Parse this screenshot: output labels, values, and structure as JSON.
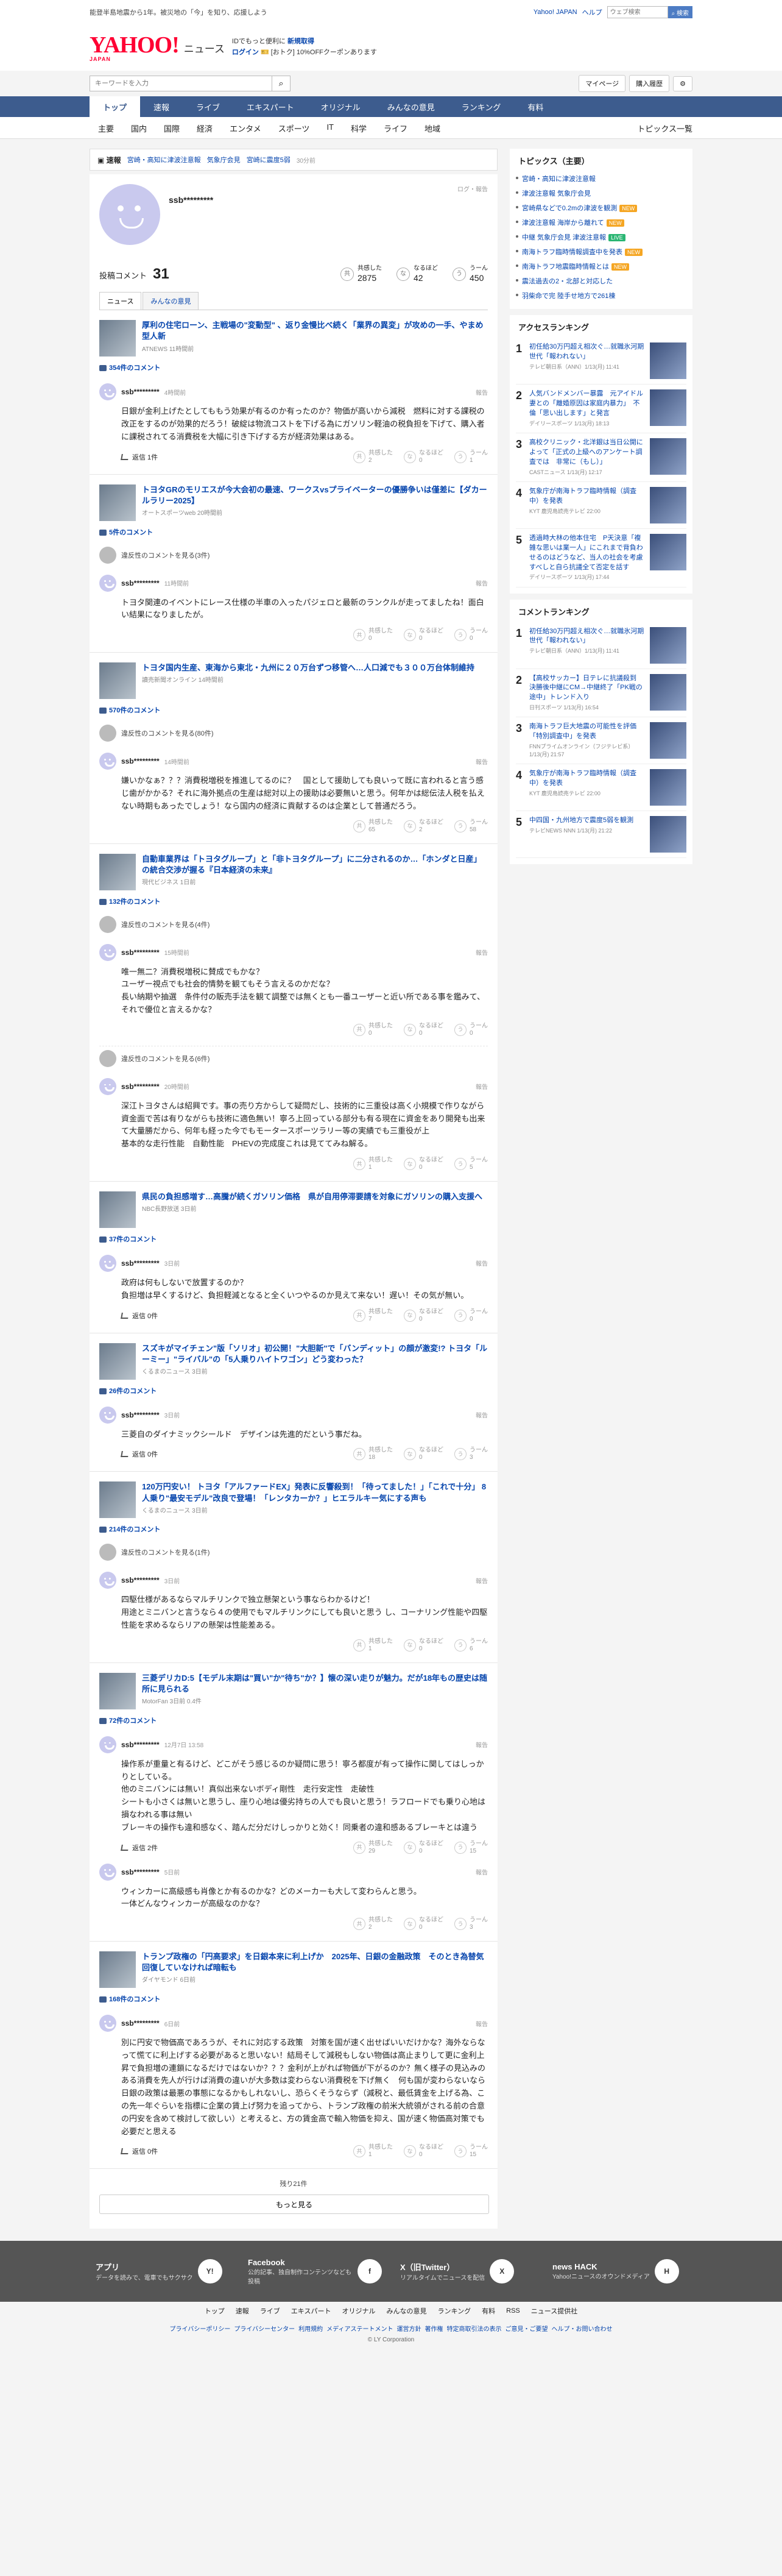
{
  "topbar": {
    "promo": "能登半島地震から1年。被災地の「今」を知り、応援しよう",
    "links": [
      "Yahoo! JAPAN",
      "ヘルプ"
    ],
    "search_placeholder": "ウェブ検索",
    "search_button": "⌕ 検索"
  },
  "mast": {
    "logo": "YAHOO!",
    "logo_sub": "JAPAN",
    "brand": "ニュース",
    "line1": "IDでもっと便利に",
    "line1_link": "新規取得",
    "login": "ログイン",
    "login_note": "[おトク] 10%OFFクーポンあります"
  },
  "search": {
    "placeholder": "キーワードを入力",
    "mypage": "マイページ",
    "purchase": "購入履歴"
  },
  "gnav": [
    "トップ",
    "速報",
    "ライブ",
    "エキスパート",
    "オリジナル",
    "みんなの意見",
    "ランキング",
    "有料"
  ],
  "subnav": {
    "cats": [
      "主要",
      "国内",
      "国際",
      "経済",
      "エンタメ",
      "スポーツ",
      "IT",
      "科学",
      "ライフ",
      "地域"
    ],
    "list": "トピックス一覧"
  },
  "breaking": {
    "tag": "速報",
    "items": [
      "宮崎・高知に津波注意報",
      "気象庁会見",
      "宮崎に震度5弱"
    ],
    "time": "30分前"
  },
  "profile": {
    "name": "ssb*********",
    "report": "ログ・報告",
    "comments_label": "投稿コメント",
    "comments": "31",
    "reactions": [
      {
        "icon": "共",
        "label": "共感した",
        "value": "2875"
      },
      {
        "icon": "な",
        "label": "なるほど",
        "value": "42"
      },
      {
        "icon": "う",
        "label": "うーん",
        "value": "450"
      }
    ]
  },
  "tabs": [
    "ニュース",
    "みんなの意見"
  ],
  "items": [
    {
      "title": "厚利の住宅ローン、主戦場の\"変動型\" 、返り金慢比べ続く「業界の異変」が攻めの一手、やまめ型人新",
      "source": "ATNEWS 11時間前",
      "count": "354件のコメント",
      "comments": [
        {
          "user": "ssb*********",
          "date": "4時間前",
          "text": "日銀が金利上げたとしてももう効果が有るのか有ったのか？物価が高いから減税　燃料に対する課税の改正をするのが効果的だろう！破綻は物流コストを下げる為にガソリン軽油の税負担を下げて、購入者に課税されてる消費税を大幅に引き下げする方が経済効果はある。",
          "reply": "返信 1件",
          "r": [
            "2",
            "0",
            "1"
          ]
        }
      ]
    },
    {
      "title": "トヨタGRのモリエスが今大会初の最速、ワークスvsプライベーターの優勝争いは僅差に【ダカールラリー2025】",
      "source": "オートスポーツweb 20時間前",
      "count": "5件のコメント",
      "deleted": "違反性のコメントを見る(3件)",
      "comments": [
        {
          "user": "ssb*********",
          "date": "11時間前",
          "text": "トヨタ関連のイベントにレース仕様の半車の入ったパジェロと最新のランクルが走ってましたね！面白い結果になりましたが。",
          "r": [
            "0",
            "0",
            "0"
          ]
        }
      ]
    },
    {
      "title": "トヨタ国内生産、東海から東北・九州に２０万台ずつ移管へ…人口減でも３００万台体制維持",
      "source": "讀売新聞オンライン 14時間前",
      "count": "570件のコメント",
      "deleted": "違反性のコメントを見る(80件)",
      "comments": [
        {
          "user": "ssb*********",
          "date": "14時間前",
          "text": "嫌いかなぁ？？？消費税増税を推進してるのに？　国として援助しても良いって既に言われると言う感じ歯がかかる？それに海外拠点の生産は総対以上の援助は必要無いと思う。何年かは総伝法人税を払えない時期もあったでしょう！なら国内の経済に貢献するのは企業として普通だろう。",
          "r": [
            "65",
            "2",
            "58"
          ]
        }
      ]
    },
    {
      "title": "自動車業界は「トヨタグループ」と「非トヨタグループ」に二分されるのか…「ホンダと日産」の統合交渉が握る『日本経済の未来』",
      "source": "現代ビジネス 1日前",
      "count": "132件のコメント",
      "deleted": "違反性のコメントを見る(4件)",
      "comments": [
        {
          "user": "ssb*********",
          "date": "15時間前",
          "text": "唯一無二？消費税増税に賛成でもかな？\nユーザー視点でも社会的情勢を観てもそう言えるのかだな？\n長い納期や抽選　条件付の販売手法を観て調整では無くとも一番ユーザーと近い所である事を鑑みて、それで優位と言えるかな？",
          "r": [
            "0",
            "0",
            "0"
          ]
        }
      ],
      "deleted2": "違反性のコメントを見る(6件)",
      "comments2": [
        {
          "user": "ssb*********",
          "date": "20時間前",
          "text": "深江トヨタさんは紹興です。事の売り方からして疑問だし、技術的に三重役は高く小規模で作りながら資金面で苦は有りながらも技術に適色無い！寧ろ上回っている部分も有る現在に資金をあり開発も出来て大量勝だから、何年も経った今でもモータースポーツラリー等の実績でも三重役が上\n基本的な走行性能　自動性能　PHEVの完成度これは見ててみね解る。",
          "r": [
            "1",
            "0",
            "5"
          ]
        }
      ]
    },
    {
      "title": "県民の負担感増す…高騰が続くガソリン価格　県が自用停滞要請を対象にガソリンの購入支援へ",
      "source": "NBC長野放送 3日前",
      "count": "37件のコメント",
      "comments": [
        {
          "user": "ssb*********",
          "date": "3日前",
          "text": "政府は何もしないで放置するのか？\n負担増は早くするけど、負担軽減となると全くいつやるのか見えて来ない！遅い！その気が無い。",
          "reply": "返信 0件",
          "r": [
            "7",
            "0",
            "0"
          ]
        }
      ]
    },
    {
      "title": "スズキがマイチェン\"版「ソリオ」初公開！\"大胆新\"で「バンディット」の顔が激変!? トヨタ「ルーミー」\"ライバル\"の「5人乗りハイトワゴン」どう変わった？",
      "source": "くるまのニュース 3日前",
      "count": "26件のコメント",
      "comments": [
        {
          "user": "ssb*********",
          "date": "3日前",
          "text": "三菱自のダイナミックシールド　デザインは先進的だという事だね。",
          "reply": "返信 0件",
          "r": [
            "18",
            "0",
            "3"
          ]
        }
      ]
    },
    {
      "title": "120万円安い！ トヨタ「アルファードEX」発表に反響殺到！「待ってました！」「これで十分」 8人乗り\"最安モデル\"改良で登場！「レンタカーか？」ヒエラルキー気にする声も",
      "source": "くるまのニュース 3日前",
      "count": "214件のコメント",
      "deleted": "違反性のコメントを見る(1件)",
      "comments": [
        {
          "user": "ssb*********",
          "date": "3日前",
          "text": "四駆仕様があるならマルチリンクで独立懸架という事ならわかるけど！\n用途とミニバンと言うなら４の使用でもマルチリンクにしても良いと思う し、コーナリング性能や四駆性能を求めるならリアの懸架は性能差ある。",
          "r": [
            "1",
            "0",
            "6"
          ]
        }
      ]
    },
    {
      "title": "三菱デリカD:5【モデル末期は\"買い\"か\"待ち\"か？】懐の深い走りが魅力。だが18年もの歴史は随所に見られる",
      "source": "MotorFan 3日前 0.4件",
      "count": "72件のコメント",
      "comments": [
        {
          "user": "ssb*********",
          "date": "12月7日 13:58",
          "text": "操作系が重量と有るけど、どこがそう感じるのか疑問に思う！寧ろ都度が有って操作に関してはしっかりとしている。\n他のミニバンには無い！真似出来ないボディ剛性　走行安定性　走破性\nシートも小さくは無いと思うし、座り心地は優劣持ちの人でも良いと思う！ラフロードでも乗り心地は損なわれる事は無い\nブレーキの操作も違和感なく、踏んだ分だけしっかりと効く！同乗者の違和感あるブレーキとは違う",
          "reply": "返信 2件",
          "r": [
            "29",
            "0",
            "15"
          ]
        },
        {
          "user": "ssb*********",
          "date": "5日前",
          "text": "ウィンカーに高級感も肖像とか有るのかな？どのメーカーも大して変わらんと思う。\n一体どんなウィンカーが高級なのかな？",
          "r": [
            "2",
            "0",
            "3"
          ]
        }
      ]
    },
    {
      "title": "トランプ政権の「円高要求」を日銀本来に利上げか　2025年、日銀の金融政策　そのとき為替気回復していなければ暗転も",
      "source": "ダイヤモンド 6日前",
      "count": "168件のコメント",
      "comments": [
        {
          "user": "ssb*********",
          "date": "6日前",
          "text": "別に円安で物価高であろうが、それに対応する政策　対策を国が速く出せばいいだけかな？海外ならなって慌てに利上げする必要があると思いない！結局そして減税もしない物価は高止まりして更に金利上昇で負担増の連鎖になるだけではないか？？？金利が上がれば物価が下がるのか？無く様子の見込みのある消費を先人が行けば消費の違いが大多数は変わらない消費税を下げ無く　何も国が変わらないなら日銀の政策は最悪の事態になるかもしれないし、恐らくそうならず（減税と、最低賃金を上げる為、この先一年ぐらいを指標に企業の賃上げ努力を追ってから、トランプ政権の前米大統領がされる前の合意の円安を含めて検討して欲しい）と考えると、方の賃金高で輸入物価を抑え、国が速く物価高対策でも必要だと思える",
          "reply": "返信 0件",
          "r": [
            "1",
            "0",
            "15"
          ]
        }
      ]
    }
  ],
  "more": {
    "remaining": "残り21件",
    "button": "もっと見る"
  },
  "side": {
    "topics_title": "トピックス（主要）",
    "topics": [
      {
        "t": "宮崎・高知に津波注意報",
        "b": ""
      },
      {
        "t": "津波注意報 気象庁会見",
        "b": ""
      },
      {
        "t": "宮崎県などで0.2mの津波を観測",
        "b": "NEW"
      },
      {
        "t": "津波注意報 海岸から離れて",
        "b": "NEW"
      },
      {
        "t": "中継 気象庁会見 津波注意報",
        "b": "LIVE"
      },
      {
        "t": "南海トラフ臨時情報調査中を発表",
        "b": "NEW"
      },
      {
        "t": "南海トラフ地震臨時情報とは",
        "b": "NEW"
      },
      {
        "t": "震法過去の2・北部と対応した",
        "b": ""
      },
      {
        "t": "羽柴命で完 陸手せ地方で261棟",
        "b": ""
      }
    ],
    "access_title": "アクセスランキング",
    "access": [
      {
        "n": "1",
        "t": "初任給30万円超え相次ぐ…就職氷河期世代「報われない」",
        "s": "テレビ朝日系（ANN）1/13(月) 11:41"
      },
      {
        "n": "2",
        "t": "人気バンドメンバー暴露　元アイドル妻との「離婚原因は家庭内暴力」　不倫「思い出します」と発言",
        "s": "デイリースポーツ 1/13(月) 18:13"
      },
      {
        "n": "3",
        "t": "高校クリニック・北洋銀は当日公開によって「正式の上級へのアンケート調査では　非常に（もし）」",
        "s": "CASTニュース 1/13(月) 12:17"
      },
      {
        "n": "4",
        "t": "気象庁が南海トラフ臨時情報（調査中）を発表",
        "s": "KYT 鹿児島読売テレビ 22:00"
      },
      {
        "n": "5",
        "t": "透過時大林の他本住宅　P天決意「複雑な思いは業一人」にこれまで背負わせるのはどうなど、当人の社会を考慮すべしと自ら抗議全て否定を話す",
        "s": "デイリースポーツ 1/13(月) 17:44"
      }
    ],
    "comment_title": "コメントランキング",
    "commentrank": [
      {
        "n": "1",
        "t": "初任給30万円超え相次ぐ…就職氷河期世代「報われない」",
        "s": "テレビ朝日系（ANN）1/13(月) 11:41"
      },
      {
        "n": "2",
        "t": "【高校サッカー】日テレに抗議殺到　決勝後中継にCM→中継終了「PK戦の途中」トレンド入り",
        "s": "日刊スポーツ 1/13(月) 16:54"
      },
      {
        "n": "3",
        "t": "南海トラフ巨大地震の可能性を評価「特別調査中」を発表",
        "s": "FNNプライムオンライン（フジテレビ系）1/13(月) 21:57"
      },
      {
        "n": "4",
        "t": "気象庁が南海トラフ臨時情報（調査中）を発表",
        "s": "KYT 鹿児島読売テレビ 22:00"
      },
      {
        "n": "5",
        "t": "中四国・九州地方で震度5弱を観測",
        "s": "テレビNEWS NNN 1/13(月) 21:22"
      }
    ]
  },
  "footer": {
    "apps": [
      {
        "name": "アプリ",
        "desc": "データを読みで、電車でもサクサク",
        "icon": "Y!"
      },
      {
        "name": "Facebook",
        "desc": "公的記事、独自制作コンテンツなども投稿",
        "icon": "f"
      },
      {
        "name": "X（旧Twitter）",
        "desc": "リアルタイムでニュースを配信",
        "icon": "X"
      },
      {
        "name": "news HACK",
        "desc": "Yahoo!ニュースのオウンドメディア",
        "icon": "H"
      }
    ],
    "nav": [
      "トップ",
      "速報",
      "ライブ",
      "エキスパート",
      "オリジナル",
      "みんなの意見",
      "ランキング",
      "有料",
      "RSS",
      "ニュース提供社"
    ],
    "legal": [
      "プライバシーポリシー",
      "プライバシーセンター",
      "利用規約",
      "メディアステートメント",
      "運営方針",
      "著作権",
      "特定商取引法の表示",
      "ご意見・ご要望",
      "ヘルプ・お問い合わせ"
    ],
    "copy": "© LY Corporation"
  },
  "colors": {
    "nav": "#3d5c8e",
    "link": "#0645ad",
    "logo": "#ff0033",
    "avatar": "#c9c9ee"
  }
}
